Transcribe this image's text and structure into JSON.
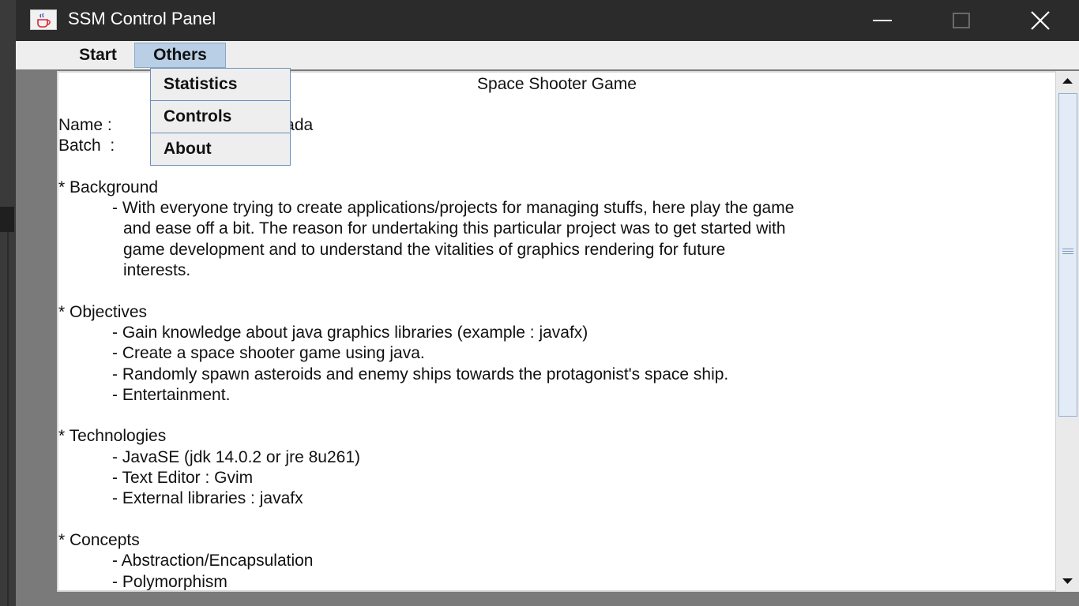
{
  "window": {
    "title": "SSM Control Panel"
  },
  "menubar": {
    "start": "Start",
    "others": "Others"
  },
  "dropdown": [
    "Statistics",
    "Controls",
    "About"
  ],
  "document": {
    "title": "Space Shooter Game",
    "name_line": "Name :",
    "name_visible_tail": "wada",
    "batch_line": "Batch  :",
    "background": {
      "heading": "* Background",
      "lines": [
        "- With everyone trying to create applications/projects for managing stuffs, here play the game",
        "and ease off a bit. The reason for undertaking this particular project was to get started with",
        "game development and to understand the vitalities of graphics rendering for future",
        "interests."
      ]
    },
    "objectives": {
      "heading": "* Objectives",
      "items": [
        "- Gain knowledge about java graphics libraries (example : javafx)",
        "- Create a space shooter game using java.",
        "- Randomly spawn asteroids and enemy ships towards the protagonist's space ship.",
        "- Entertainment."
      ]
    },
    "technologies": {
      "heading": "* Technologies",
      "items": [
        "- JavaSE (jdk 14.0.2 or jre 8u261)",
        "- Text Editor : Gvim",
        "- External libraries : javafx"
      ]
    },
    "concepts": {
      "heading": "* Concepts",
      "items": [
        "- Abstraction/Encapsulation",
        "- Polymorphism"
      ]
    }
  },
  "icons": {
    "app": "java-cup-icon",
    "minimize": "minimize-icon",
    "maximize": "maximize-icon",
    "close": "close-icon",
    "scroll_up": "scroll-up-arrow-icon",
    "scroll_down": "scroll-down-arrow-icon"
  },
  "colors": {
    "titlebar": "#2b2b2b",
    "menu_selected": "#b8cfe5",
    "dropdown_border": "#6d8fbe"
  }
}
